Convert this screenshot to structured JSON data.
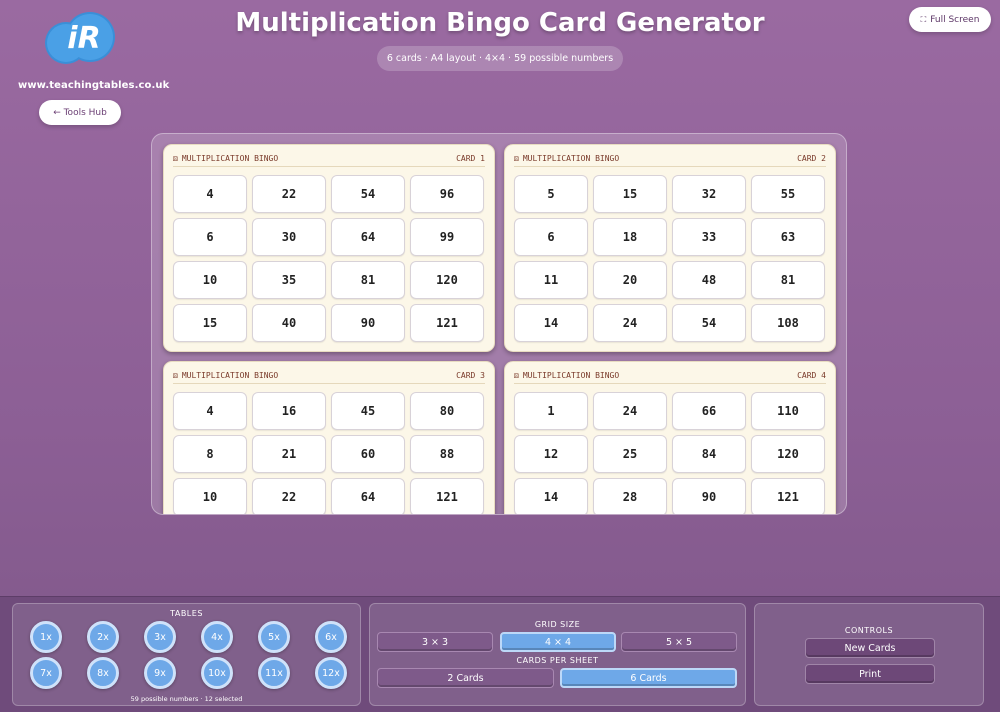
{
  "header": {
    "site_url": "www.teachingtables.co.uk",
    "logo_text": "iR",
    "tools_hub_label": "← Tools Hub",
    "title": "Multiplication Bingo Card Generator",
    "subtitle": "6 cards · A4 layout · 4×4 · 59 possible numbers",
    "fullscreen_label": "Full Screen"
  },
  "cards": [
    {
      "heading": "MULTIPLICATION BINGO",
      "label": "CARD 1",
      "numbers": [
        "4",
        "22",
        "54",
        "96",
        "6",
        "30",
        "64",
        "99",
        "10",
        "35",
        "81",
        "120",
        "15",
        "40",
        "90",
        "121"
      ]
    },
    {
      "heading": "MULTIPLICATION BINGO",
      "label": "CARD 2",
      "numbers": [
        "5",
        "15",
        "32",
        "55",
        "6",
        "18",
        "33",
        "63",
        "11",
        "20",
        "48",
        "81",
        "14",
        "24",
        "54",
        "108"
      ]
    },
    {
      "heading": "MULTIPLICATION BINGO",
      "label": "CARD 3",
      "numbers": [
        "4",
        "16",
        "45",
        "80",
        "8",
        "21",
        "60",
        "88",
        "10",
        "22",
        "64",
        "121"
      ]
    },
    {
      "heading": "MULTIPLICATION BINGO",
      "label": "CARD 4",
      "numbers": [
        "1",
        "24",
        "66",
        "110",
        "12",
        "25",
        "84",
        "120",
        "14",
        "28",
        "90",
        "121"
      ]
    }
  ],
  "tables": {
    "title": "TABLES",
    "items": [
      "1x",
      "2x",
      "3x",
      "4x",
      "5x",
      "6x",
      "7x",
      "8x",
      "9x",
      "10x",
      "11x",
      "12x"
    ],
    "status": "59 possible numbers · 12 selected"
  },
  "grid_size": {
    "title": "GRID SIZE",
    "options": [
      "3 × 3",
      "4 × 4",
      "5 × 5"
    ],
    "selected": "4 × 4"
  },
  "cards_per_sheet": {
    "title": "CARDS PER SHEET",
    "options": [
      "2 Cards",
      "6 Cards"
    ],
    "selected": "6 Cards"
  },
  "controls": {
    "title": "CONTROLS",
    "new_cards_label": "New Cards",
    "print_label": "Print"
  },
  "colors": {
    "background": "#8c5f95",
    "accent_blue": "#6ea8e8",
    "card_bg": "#fcf7e8"
  }
}
